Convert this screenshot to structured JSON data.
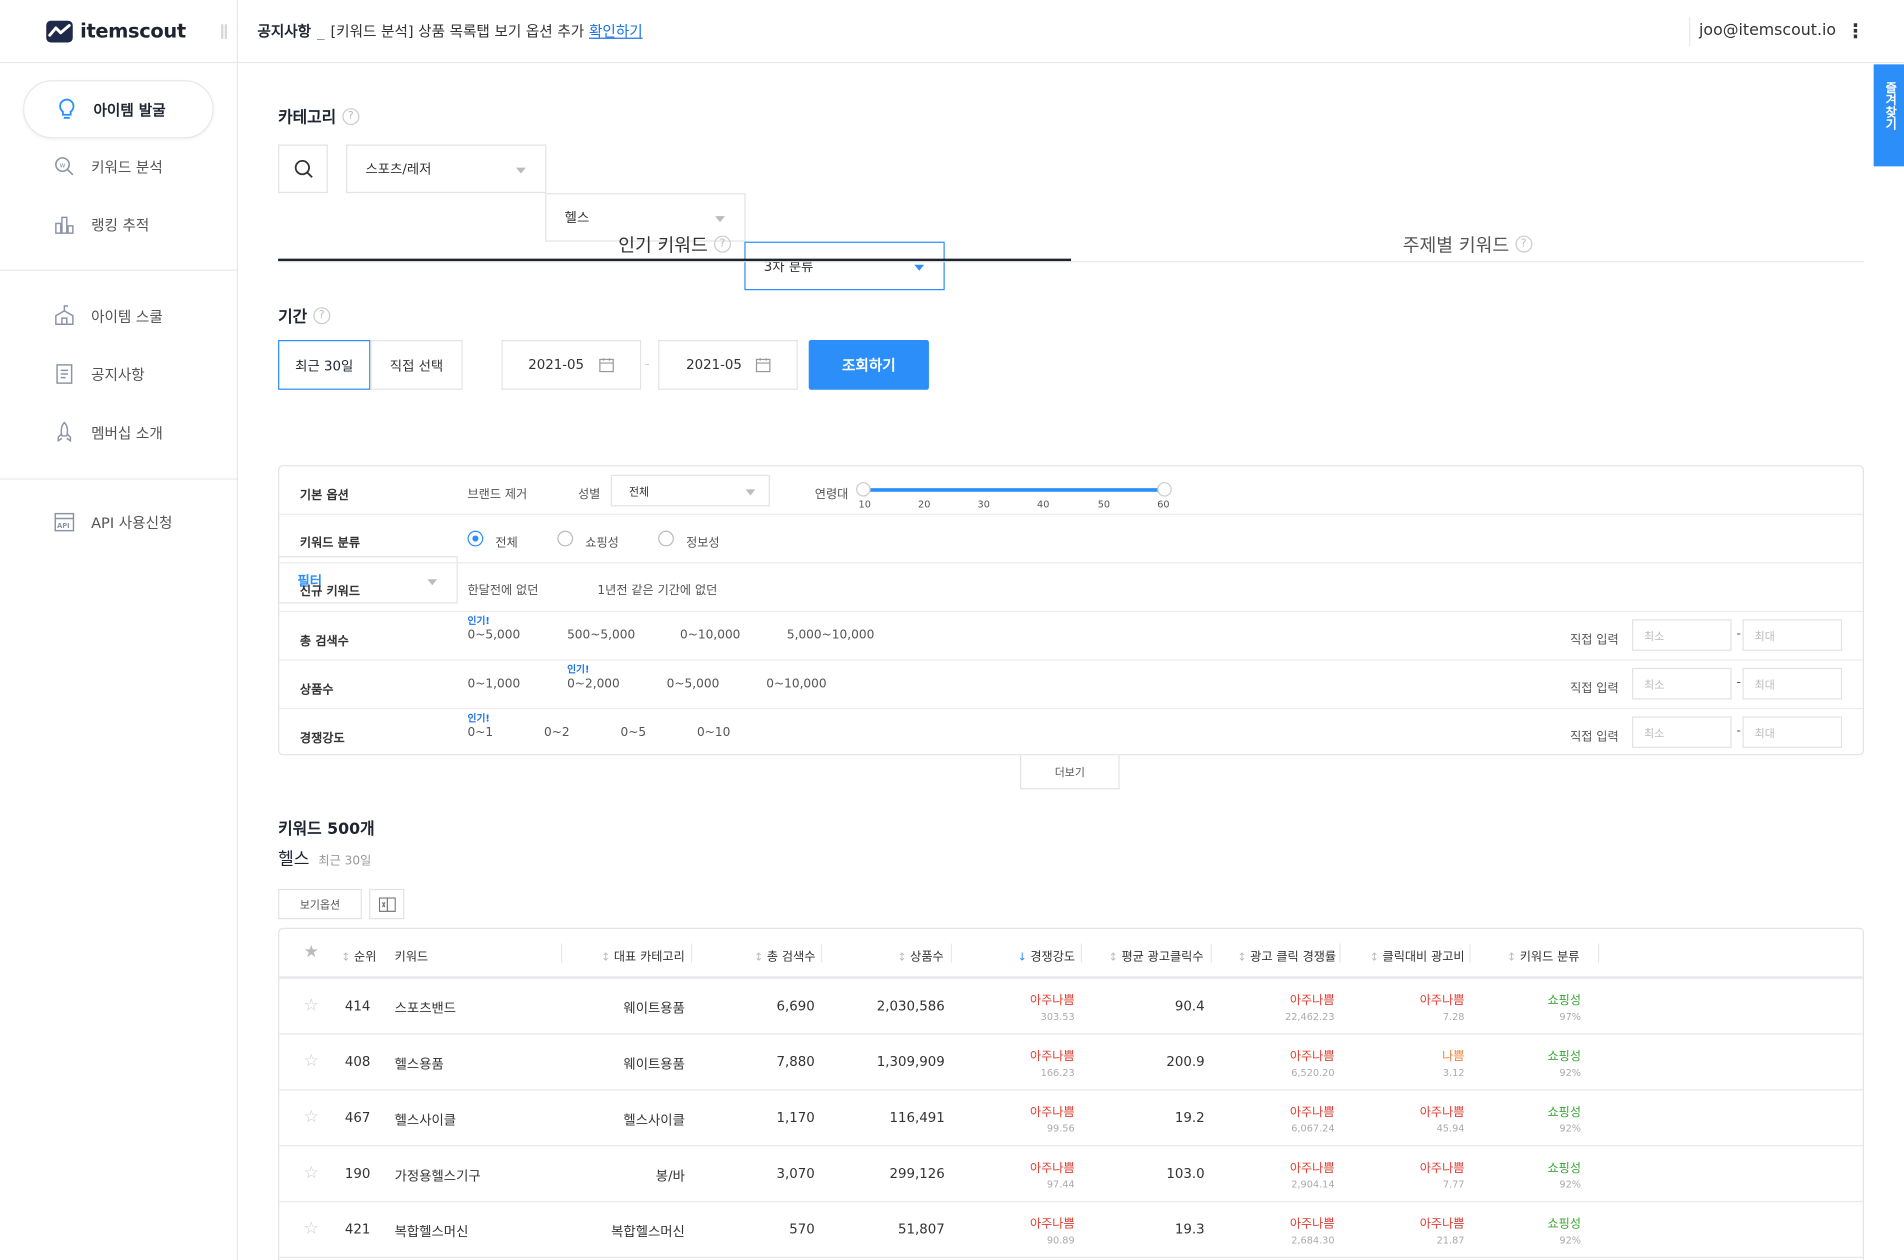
{
  "app": {
    "logo_text": "itemscout"
  },
  "sidebar": {
    "items": [
      {
        "label": "아이템 발굴",
        "icon": "bulb-icon",
        "active": true
      },
      {
        "label": "키워드 분석",
        "icon": "keyword-search-icon"
      },
      {
        "label": "랭킹 추적",
        "icon": "bar-chart-icon"
      },
      {
        "label": "아이템 스쿨",
        "icon": "school-icon"
      },
      {
        "label": "공지사항",
        "icon": "notice-icon"
      },
      {
        "label": "멤버십 소개",
        "icon": "rocket-icon"
      },
      {
        "label": "API 사용신청",
        "icon": "api-icon"
      }
    ]
  },
  "topbar": {
    "notice_title": "공지사항",
    "separator": "_",
    "notice_text": "[키워드 분석] 상품 목록탭 보기 옵션 추가",
    "notice_link": "확인하기",
    "email": "joo@itemscout.io",
    "menu_glyph": "⋮"
  },
  "side_tab": {
    "label": "즐겨찾기"
  },
  "category": {
    "title": "카테고리",
    "help": "?",
    "level1": "스포츠/레저",
    "level2": "헬스",
    "level3": "3차 분류"
  },
  "tabs": [
    {
      "label": "인기 키워드",
      "active": true
    },
    {
      "label": "주제별 키워드",
      "active": false
    }
  ],
  "period": {
    "title": "기간",
    "opt_recent": "최근 30일",
    "opt_custom": "직접 선택",
    "start": "2021-05",
    "end": "2021-05",
    "dash": "-",
    "search_btn": "조회하기"
  },
  "filter": {
    "select_label": "필터",
    "basic": {
      "label": "기본 옵션",
      "brand": "브랜드 제거",
      "gender_label": "성별",
      "gender_value": "전체",
      "age_label": "연령대",
      "age_ticks": [
        "10",
        "20",
        "30",
        "40",
        "50",
        "60"
      ],
      "age_range": [
        10,
        60
      ]
    },
    "kwtype": {
      "label": "키워드 분류",
      "options": [
        "전체",
        "쇼핑성",
        "정보성"
      ],
      "selected": "전체"
    },
    "newkw": {
      "label": "신규 키워드",
      "options": [
        "한달전에 없던",
        "1년전 같은 기간에 없던"
      ]
    },
    "total_search": {
      "label": "총 검색수",
      "options": [
        "0~5,000",
        "500~5,000",
        "0~10,000",
        "5,000~10,000"
      ],
      "popular_index": 0
    },
    "products": {
      "label": "상품수",
      "options": [
        "0~1,000",
        "0~2,000",
        "0~5,000",
        "0~10,000"
      ],
      "popular_index": 1
    },
    "competition": {
      "label": "경쟁강도",
      "options": [
        "0~1",
        "0~2",
        "0~5",
        "0~10"
      ],
      "popular_index": 0
    },
    "popular_tag": "인기!",
    "direct_input": "직접 입력",
    "min_placeholder": "최소",
    "max_placeholder": "최대",
    "range_dash": "-",
    "more_btn": "더보기"
  },
  "results": {
    "count_title": "키워드 500개",
    "subtitle": "헬스",
    "subtitle_period": "최근 30일",
    "view_options_btn": "보기옵션",
    "excel_icon": "excel-download-icon"
  },
  "table": {
    "columns": [
      "순위",
      "키워드",
      "대표 카테고리",
      "총 검색수",
      "상품수",
      "경쟁강도",
      "평균 광고클릭수",
      "광고 클릭 경쟁률",
      "클릭대비 광고비",
      "키워드 분류"
    ],
    "sort_arrows": {
      "default": "↕",
      "active": "↓"
    },
    "rows": [
      {
        "rank": "414",
        "keyword": "스포츠밴드",
        "category": "웨이트용품",
        "searches": "6,690",
        "products": "2,030,586",
        "comp": "아주나쁨",
        "comp_val": "303.53",
        "ad_clicks": "90.4",
        "ad_comp": "아주나쁨",
        "ad_comp_val": "22,462.23",
        "cost": "아주나쁨",
        "cost_val": "7.28",
        "type": "쇼핑성",
        "type_val": "97%"
      },
      {
        "rank": "408",
        "keyword": "헬스용품",
        "category": "웨이트용품",
        "searches": "7,880",
        "products": "1,309,909",
        "comp": "아주나쁨",
        "comp_val": "166.23",
        "ad_clicks": "200.9",
        "ad_comp": "아주나쁨",
        "ad_comp_val": "6,520.20",
        "cost": "나쁨",
        "cost_val": "3.12",
        "type": "쇼핑성",
        "type_val": "92%"
      },
      {
        "rank": "467",
        "keyword": "헬스사이클",
        "category": "헬스사이클",
        "searches": "1,170",
        "products": "116,491",
        "comp": "아주나쁨",
        "comp_val": "99.56",
        "ad_clicks": "19.2",
        "ad_comp": "아주나쁨",
        "ad_comp_val": "6,067.24",
        "cost": "아주나쁨",
        "cost_val": "45.94",
        "type": "쇼핑성",
        "type_val": "92%"
      },
      {
        "rank": "190",
        "keyword": "가정용헬스기구",
        "category": "봉/바",
        "searches": "3,070",
        "products": "299,126",
        "comp": "아주나쁨",
        "comp_val": "97.44",
        "ad_clicks": "103.0",
        "ad_comp": "아주나쁨",
        "ad_comp_val": "2,904.14",
        "cost": "아주나쁨",
        "cost_val": "7.77",
        "type": "쇼핑성",
        "type_val": "92%"
      },
      {
        "rank": "421",
        "keyword": "복합헬스머신",
        "category": "복합헬스머신",
        "searches": "570",
        "products": "51,807",
        "comp": "아주나쁨",
        "comp_val": "90.89",
        "ad_clicks": "19.3",
        "ad_comp": "아주나쁨",
        "ad_comp_val": "2,684.30",
        "cost": "아주나쁨",
        "cost_val": "21.87",
        "type": "쇼핑성",
        "type_val": "92%"
      }
    ]
  },
  "colors": {
    "accent": "#2c8ef8",
    "very_bad": "#e03c31",
    "bad": "#f0803c",
    "shopping": "#3aa935"
  }
}
